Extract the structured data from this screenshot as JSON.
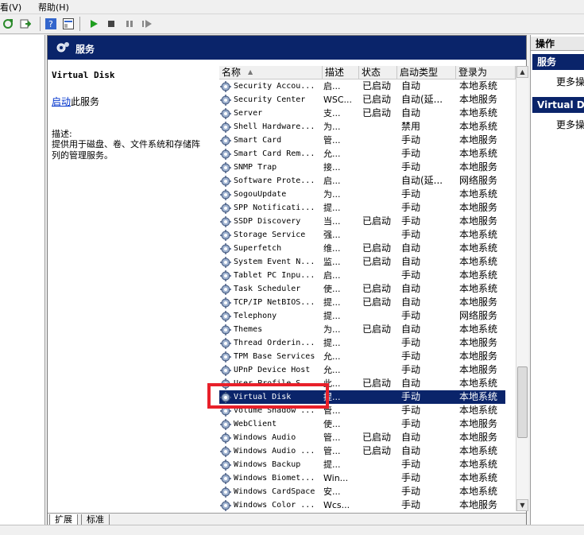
{
  "menu": {
    "view": "看(V)",
    "help": "帮助(H)"
  },
  "panel_title": "服务",
  "details": {
    "service_name": "Virtual Disk",
    "start_link": "启动",
    "start_suffix": "此服务",
    "description_label": "描述:",
    "description_text": "提供用于磁盘、卷、文件系统和存储阵列的管理服务。"
  },
  "columns": {
    "name": "名称",
    "description": "描述",
    "status": "状态",
    "startup": "启动类型",
    "logon": "登录为"
  },
  "services": [
    {
      "name": "Security Accou...",
      "desc": "启...",
      "status": "已启动",
      "startup": "自动",
      "logon": "本地系统"
    },
    {
      "name": "Security Center",
      "desc": "WSC...",
      "status": "已启动",
      "startup": "自动(延...",
      "logon": "本地服务"
    },
    {
      "name": "Server",
      "desc": "支...",
      "status": "已启动",
      "startup": "自动",
      "logon": "本地系统"
    },
    {
      "name": "Shell Hardware...",
      "desc": "为...",
      "status": "",
      "startup": "禁用",
      "logon": "本地系统"
    },
    {
      "name": "Smart Card",
      "desc": "管...",
      "status": "",
      "startup": "手动",
      "logon": "本地服务"
    },
    {
      "name": "Smart Card Rem...",
      "desc": "允...",
      "status": "",
      "startup": "手动",
      "logon": "本地系统"
    },
    {
      "name": "SNMP Trap",
      "desc": "接...",
      "status": "",
      "startup": "手动",
      "logon": "本地服务"
    },
    {
      "name": "Software Prote...",
      "desc": "启...",
      "status": "",
      "startup": "自动(延...",
      "logon": "网络服务"
    },
    {
      "name": "SogouUpdate",
      "desc": "为...",
      "status": "",
      "startup": "手动",
      "logon": "本地系统"
    },
    {
      "name": "SPP Notificati...",
      "desc": "提...",
      "status": "",
      "startup": "手动",
      "logon": "本地服务"
    },
    {
      "name": "SSDP Discovery",
      "desc": "当...",
      "status": "已启动",
      "startup": "手动",
      "logon": "本地服务"
    },
    {
      "name": "Storage Service",
      "desc": "强...",
      "status": "",
      "startup": "手动",
      "logon": "本地系统"
    },
    {
      "name": "Superfetch",
      "desc": "维...",
      "status": "已启动",
      "startup": "自动",
      "logon": "本地系统"
    },
    {
      "name": "System Event N...",
      "desc": "监...",
      "status": "已启动",
      "startup": "自动",
      "logon": "本地系统"
    },
    {
      "name": "Tablet PC Inpu...",
      "desc": "启...",
      "status": "",
      "startup": "手动",
      "logon": "本地系统"
    },
    {
      "name": "Task Scheduler",
      "desc": "使...",
      "status": "已启动",
      "startup": "自动",
      "logon": "本地系统"
    },
    {
      "name": "TCP/IP NetBIOS...",
      "desc": "提...",
      "status": "已启动",
      "startup": "自动",
      "logon": "本地服务"
    },
    {
      "name": "Telephony",
      "desc": "提...",
      "status": "",
      "startup": "手动",
      "logon": "网络服务"
    },
    {
      "name": "Themes",
      "desc": "为...",
      "status": "已启动",
      "startup": "自动",
      "logon": "本地系统"
    },
    {
      "name": "Thread Orderin...",
      "desc": "提...",
      "status": "",
      "startup": "手动",
      "logon": "本地服务"
    },
    {
      "name": "TPM Base Services",
      "desc": "允...",
      "status": "",
      "startup": "手动",
      "logon": "本地服务"
    },
    {
      "name": "UPnP Device Host",
      "desc": "允...",
      "status": "",
      "startup": "手动",
      "logon": "本地服务"
    },
    {
      "name": "User Profile S...",
      "desc": "此...",
      "status": "已启动",
      "startup": "自动",
      "logon": "本地系统"
    },
    {
      "name": "Virtual Disk",
      "desc": "提...",
      "status": "",
      "startup": "手动",
      "logon": "本地系统"
    },
    {
      "name": "Volume Shadow ...",
      "desc": "管...",
      "status": "",
      "startup": "手动",
      "logon": "本地系统"
    },
    {
      "name": "WebClient",
      "desc": "使...",
      "status": "",
      "startup": "手动",
      "logon": "本地服务"
    },
    {
      "name": "Windows Audio",
      "desc": "管...",
      "status": "已启动",
      "startup": "自动",
      "logon": "本地服务"
    },
    {
      "name": "Windows Audio ...",
      "desc": "管...",
      "status": "已启动",
      "startup": "自动",
      "logon": "本地系统"
    },
    {
      "name": "Windows Backup",
      "desc": "提...",
      "status": "",
      "startup": "手动",
      "logon": "本地系统"
    },
    {
      "name": "Windows Biomet...",
      "desc": "Win...",
      "status": "",
      "startup": "手动",
      "logon": "本地系统"
    },
    {
      "name": "Windows CardSpace",
      "desc": "安...",
      "status": "",
      "startup": "手动",
      "logon": "本地系统"
    },
    {
      "name": "Windows Color ...",
      "desc": "Wcs...",
      "status": "",
      "startup": "手动",
      "logon": "本地服务"
    }
  ],
  "selected_index": 23,
  "tabs": {
    "extended": "扩展",
    "standard": "标准"
  },
  "actions": {
    "header": "操作",
    "section1": "服务",
    "more1": "更多操",
    "section2": "Virtual D",
    "more2": "更多操"
  },
  "colors": {
    "selection": "#0a246a",
    "highlight_box": "#e8202a",
    "link": "#0033cc"
  }
}
